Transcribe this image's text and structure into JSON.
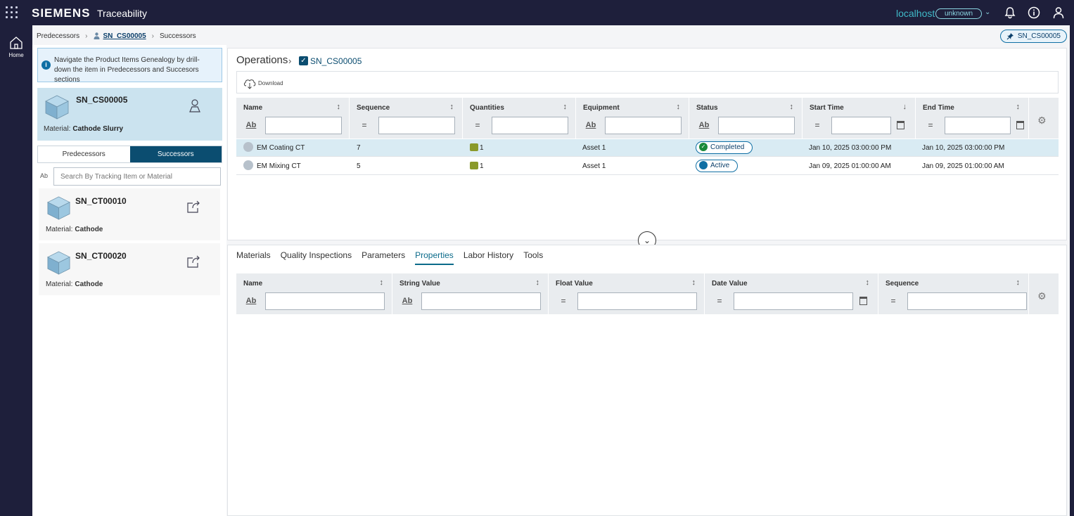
{
  "topbar": {
    "brand": "SIEMENS",
    "app_title": "Traceability",
    "host": "localhost",
    "host_status": "unknown"
  },
  "rail": {
    "home_label": "Home"
  },
  "breadcrumb": {
    "predecessors": "Predecessors",
    "current": "SN_CS00005",
    "successors": "Successors"
  },
  "pinned_chip": "SN_CS00005",
  "info_message": "Navigate the Product Items Genealogy by drill-down the item in Predecessors and Succesors sections",
  "selected_item": {
    "title": "SN_CS00005",
    "material_label": "Material:",
    "material_value": "Cathode Slurry"
  },
  "genealogy_tabs": {
    "predecessors": "Predecessors",
    "successors": "Successors"
  },
  "search": {
    "placeholder": "Search By Tracking Item or Material",
    "ab": "Ab"
  },
  "successor_items": [
    {
      "title": "SN_CT00010",
      "material_label": "Material:",
      "material_value": "Cathode"
    },
    {
      "title": "SN_CT00020",
      "material_label": "Material:",
      "material_value": "Cathode"
    }
  ],
  "operations": {
    "title": "Operations",
    "context": "SN_CS00005",
    "download_label": "Download",
    "columns": [
      "Name",
      "Sequence",
      "Quantities",
      "Equipment",
      "Status",
      "Start Time",
      "End Time"
    ],
    "filter_ops": [
      "Ab",
      "=",
      "=",
      "Ab",
      "Ab",
      "=",
      "="
    ],
    "rows": [
      {
        "name": "EM Coating CT",
        "sequence": "7",
        "quantity": "1",
        "equipment": "Asset 1",
        "status": "Completed",
        "start": "Jan 10, 2025 03:00:00 PM",
        "end": "Jan 10, 2025 03:00:00 PM"
      },
      {
        "name": "EM Mixing CT",
        "sequence": "5",
        "quantity": "1",
        "equipment": "Asset 1",
        "status": "Active",
        "start": "Jan 09, 2025 01:00:00 AM",
        "end": "Jan 09, 2025 01:00:00 AM"
      }
    ],
    "status_colors": {
      "Completed": "#1a8a3a",
      "Active": "#0f6fa4"
    }
  },
  "detail_tabs": [
    "Materials",
    "Quality Inspections",
    "Parameters",
    "Properties",
    "Labor History",
    "Tools"
  ],
  "detail_active_tab": "Properties",
  "properties": {
    "columns": [
      "Name",
      "String Value",
      "Float Value",
      "Date Value",
      "Sequence"
    ],
    "filter_ops": [
      "Ab",
      "Ab",
      "=",
      "=",
      "="
    ]
  },
  "colors": {
    "topbar_bg": "#1e1f3b",
    "accent": "#0b4d70",
    "highlight_row": "#d9ebf3"
  }
}
